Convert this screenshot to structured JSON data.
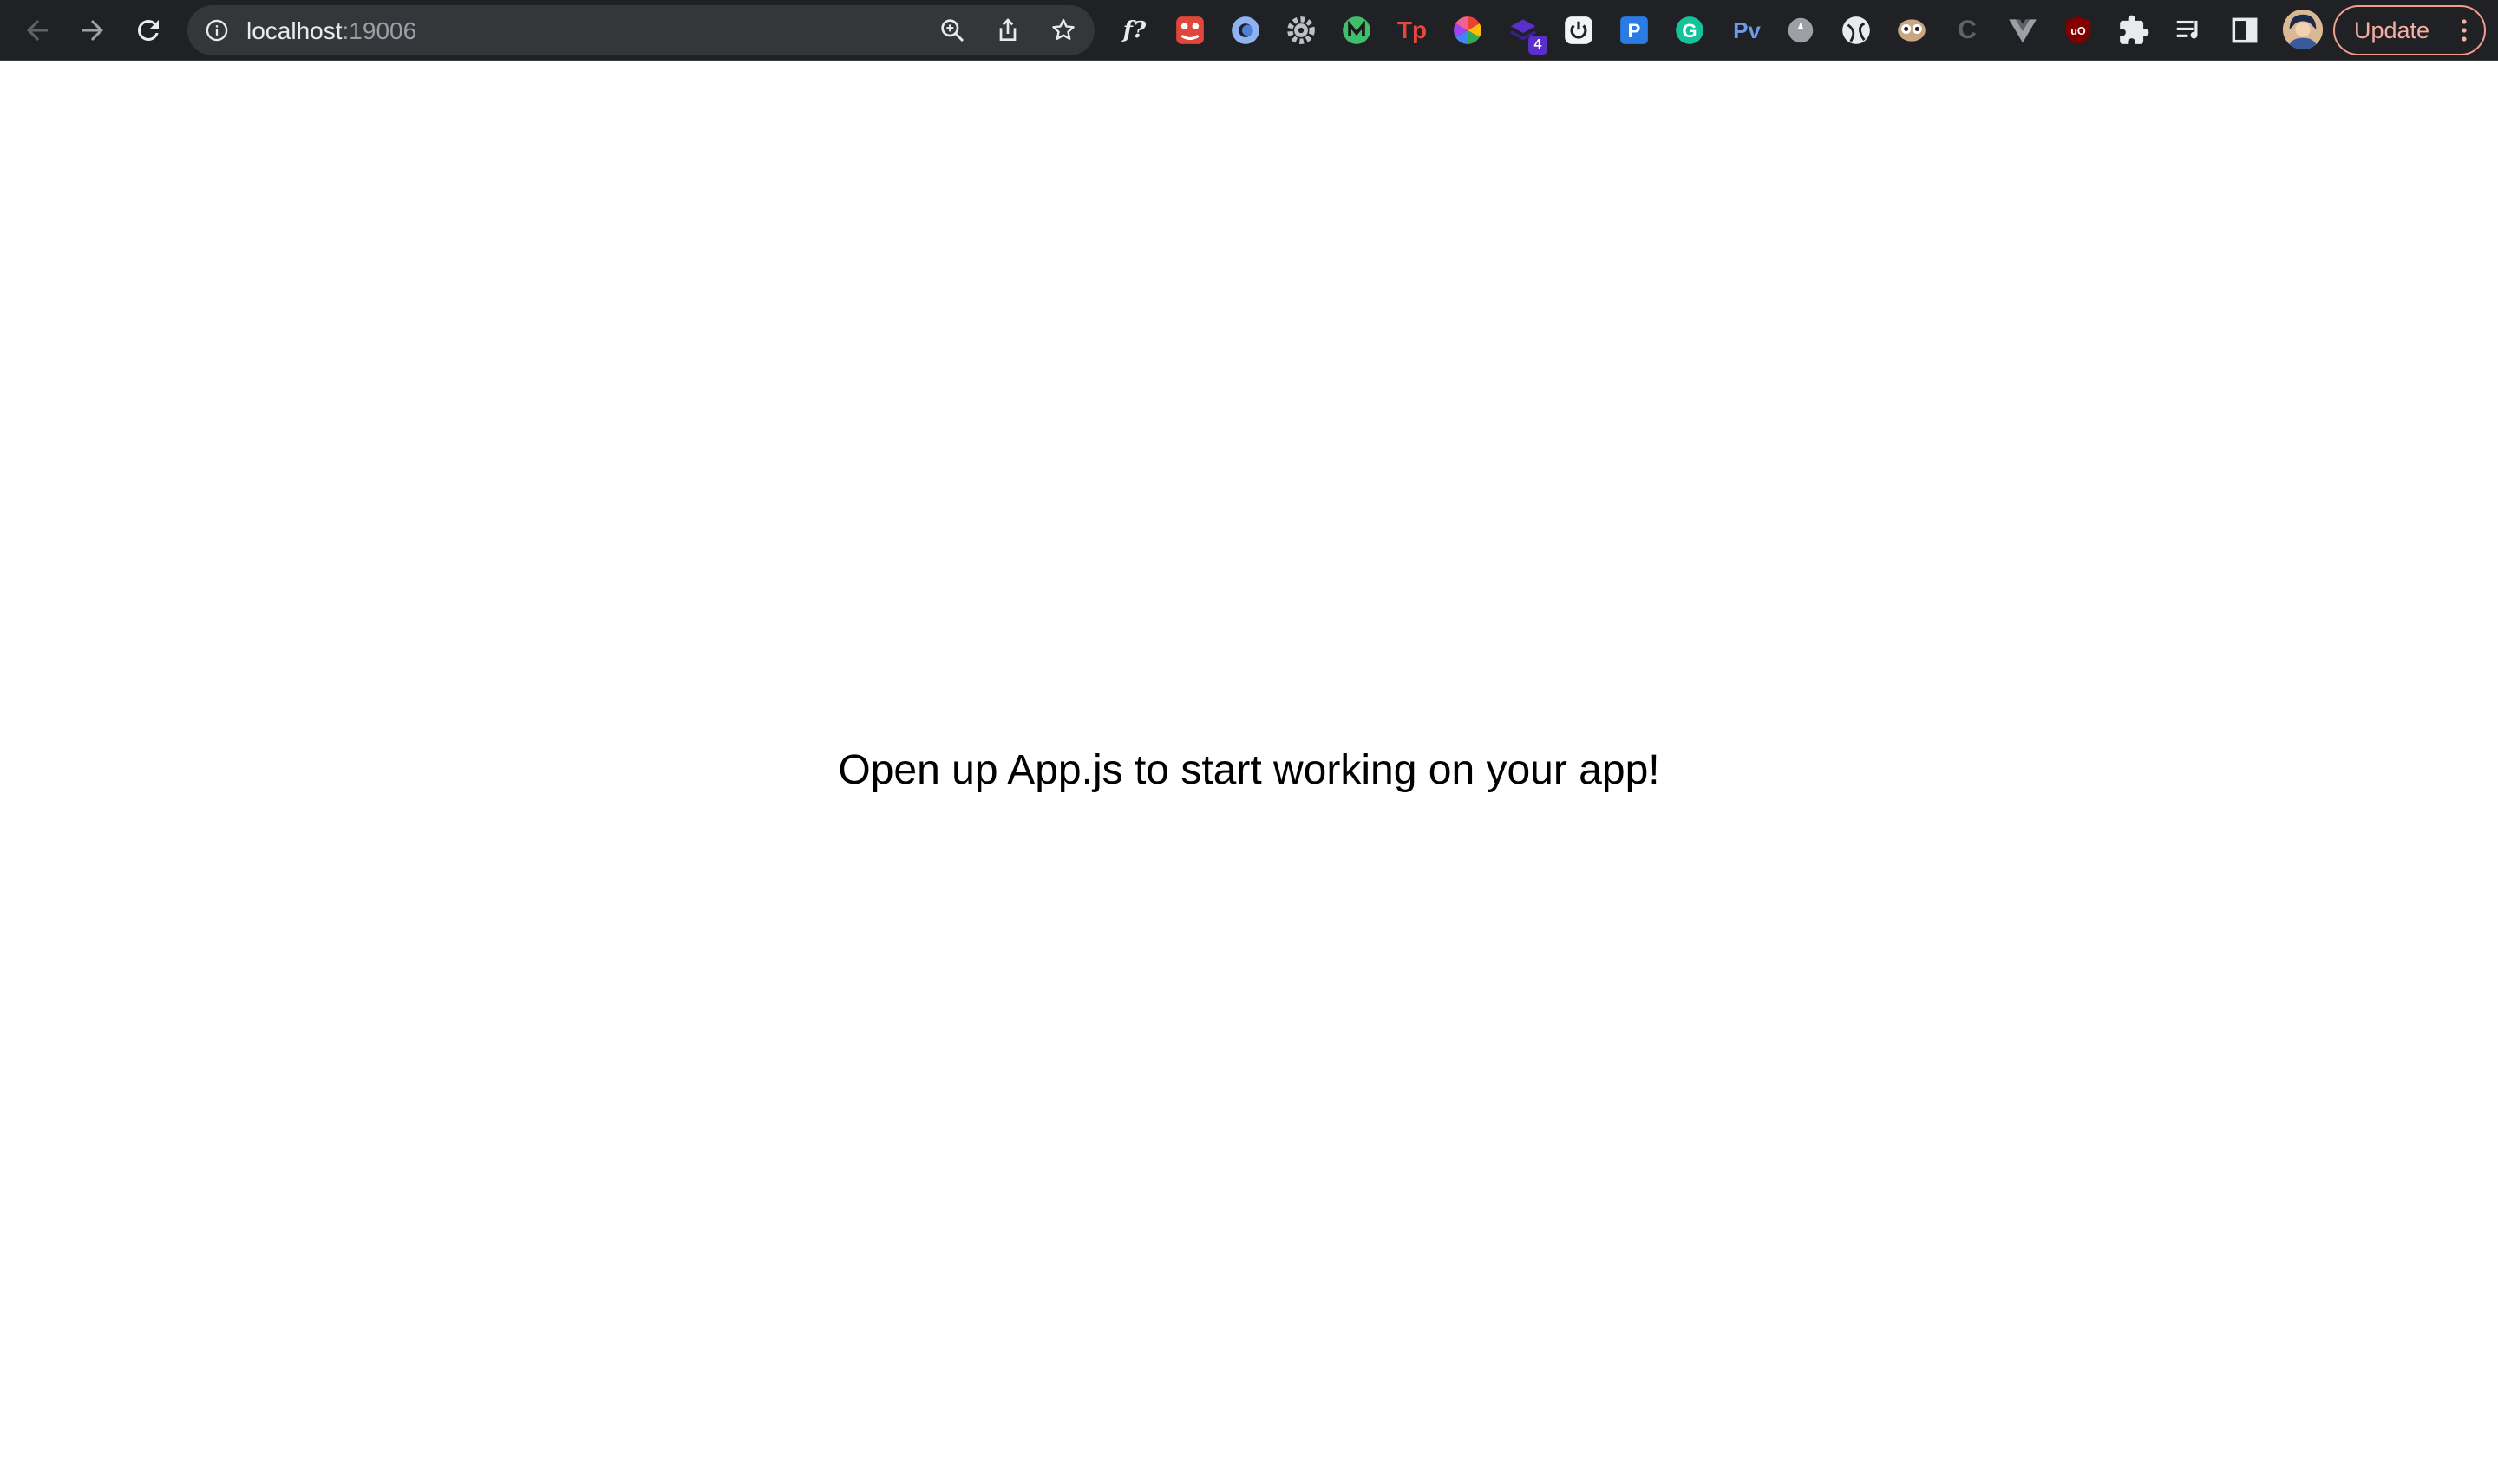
{
  "browser": {
    "address_bar": {
      "host": "localhost",
      "port": ":19006"
    },
    "update_button_label": "Update",
    "extensions": [
      {
        "name": "fontface-ninja-icon",
        "text": "f?"
      },
      {
        "name": "red-extension-icon",
        "text": ""
      },
      {
        "name": "blue-circle-extension-icon",
        "text": ""
      },
      {
        "name": "gear-extension-icon",
        "text": ""
      },
      {
        "name": "green-extension-icon",
        "text": ""
      },
      {
        "name": "tp-extension-icon",
        "text": "Tp"
      },
      {
        "name": "color-wheel-extension-icon",
        "text": ""
      },
      {
        "name": "purple-stack-extension-icon",
        "text": "",
        "badge": "4"
      },
      {
        "name": "power-extension-icon",
        "text": ""
      },
      {
        "name": "p-extension-icon",
        "text": "P"
      },
      {
        "name": "grammarly-icon",
        "text": "G"
      },
      {
        "name": "pv-extension-icon",
        "text": "Pv"
      },
      {
        "name": "grey-circle-extension-icon",
        "text": ""
      },
      {
        "name": "globe-extension-icon",
        "text": ""
      },
      {
        "name": "owl-extension-icon",
        "text": ""
      },
      {
        "name": "c-extension-icon",
        "text": "C"
      },
      {
        "name": "vue-devtools-icon",
        "text": ""
      },
      {
        "name": "ublock-origin-icon",
        "text": "uO"
      }
    ],
    "colors": {
      "toolbar_bg": "#202124",
      "omnibox_bg": "#35363a",
      "update_accent": "#f29b8e"
    }
  },
  "page": {
    "message": "Open up App.js to start working on your app!"
  }
}
